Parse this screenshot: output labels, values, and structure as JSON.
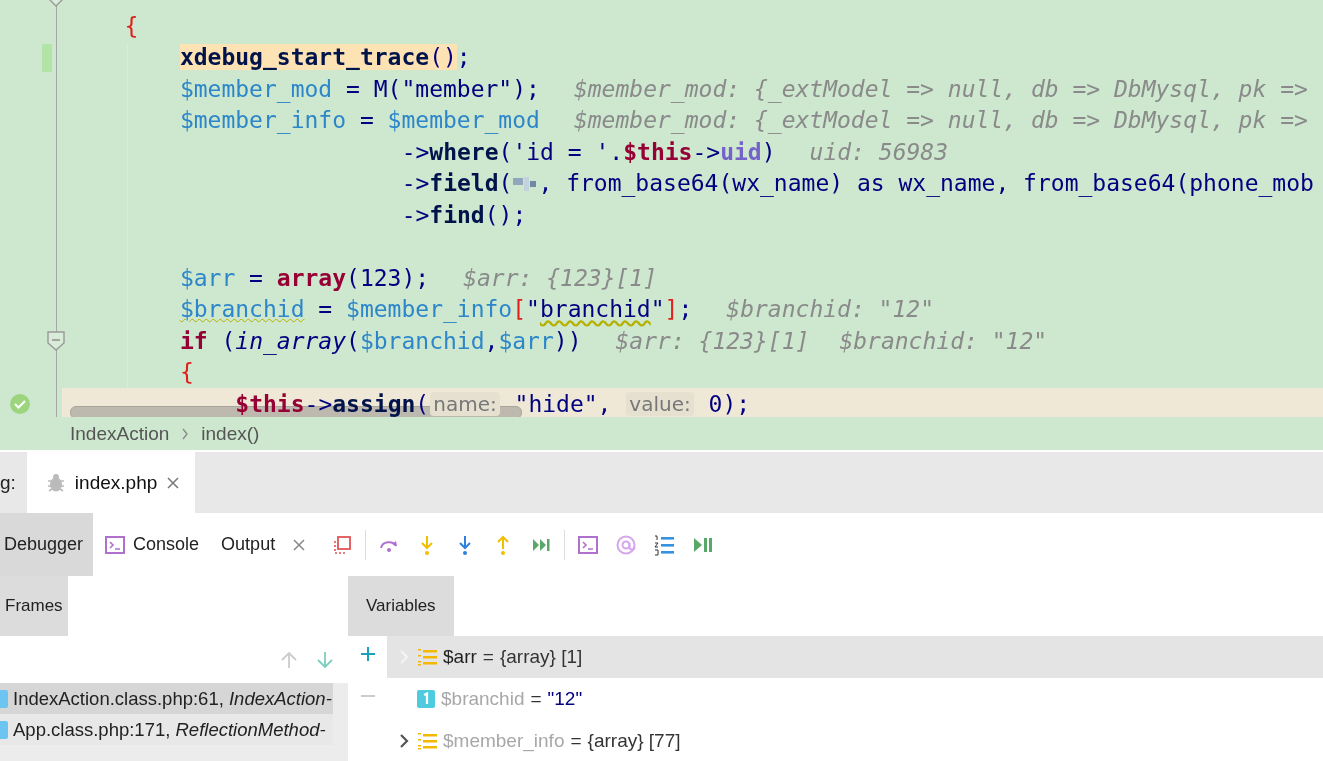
{
  "editor": {
    "lines": [
      {
        "kind": "block",
        "tokens": [
          {
            "t": "{",
            "kind": "brace"
          }
        ]
      },
      {
        "kind": "stmt",
        "tokens": [
          {
            "t": "xdebug_start_trace",
            "kind": "callmark"
          },
          {
            "t": "()",
            "kind": "textmark"
          },
          {
            "t": ";",
            "kind": "text"
          }
        ],
        "changed": true
      },
      {
        "kind": "stmt",
        "tokens": [
          {
            "t": "$member_mod",
            "kind": "var"
          },
          {
            "t": " = M(\"member\");",
            "kind": "text"
          }
        ],
        "hints": [
          "$member_mod: {_extModel => null, db => DbMysql, pk =>"
        ]
      },
      {
        "kind": "stmt",
        "tokens": [
          {
            "t": "$member_info",
            "kind": "var"
          },
          {
            "t": " = ",
            "kind": "text"
          },
          {
            "t": "$member_mod",
            "kind": "var"
          }
        ],
        "hints": [
          "$member_mod: {_extModel => null, db => DbMysql, pk =>"
        ]
      },
      {
        "kind": "chain",
        "tokens": [
          {
            "t": "->",
            "kind": "text"
          },
          {
            "t": "where",
            "kind": "call"
          },
          {
            "t": "('id = '.",
            "kind": "text"
          },
          {
            "t": "$this",
            "kind": "kw"
          },
          {
            "t": "->",
            "kind": "text"
          },
          {
            "t": "uid",
            "kind": "prop"
          },
          {
            "t": ")",
            "kind": "text"
          }
        ],
        "hints": [
          "uid: 56983"
        ]
      },
      {
        "kind": "chain",
        "tokens": [
          {
            "t": "->",
            "kind": "text"
          },
          {
            "t": "field",
            "kind": "call"
          },
          {
            "t": "(",
            "kind": "text"
          },
          {
            "kind": "redacted"
          },
          {
            "t": ", from_base64(wx_name) as wx_name, from_base64(phone_mob",
            "kind": "text"
          }
        ]
      },
      {
        "kind": "chain",
        "tokens": [
          {
            "t": "->",
            "kind": "text"
          },
          {
            "t": "find",
            "kind": "call"
          },
          {
            "t": "();",
            "kind": "text"
          }
        ]
      },
      {
        "kind": "blank"
      },
      {
        "kind": "stmt",
        "tokens": [
          {
            "t": "$arr",
            "kind": "var"
          },
          {
            "t": " = ",
            "kind": "text"
          },
          {
            "t": "array",
            "kind": "kw"
          },
          {
            "t": "(123);",
            "kind": "text"
          }
        ],
        "hints": [
          "$arr: {123}[1]"
        ]
      },
      {
        "kind": "stmt",
        "tokens": [
          {
            "t": "$branchid",
            "kind": "varwarn"
          },
          {
            "t": " = ",
            "kind": "text"
          },
          {
            "t": "$member_info",
            "kind": "var"
          },
          {
            "t": "[",
            "kind": "brace"
          },
          {
            "t": "\"",
            "kind": "text"
          },
          {
            "t": "branchid",
            "kind": "textwarn"
          },
          {
            "t": "\"",
            "kind": "text"
          },
          {
            "t": "]",
            "kind": "brace"
          },
          {
            "t": ";",
            "kind": "text"
          }
        ],
        "hints": [
          "$branchid: \"12\""
        ]
      },
      {
        "kind": "stmt",
        "tokens": [
          {
            "t": "if",
            "kind": "kw"
          },
          {
            "t": " (",
            "kind": "text"
          },
          {
            "t": "in_array",
            "kind": "italic"
          },
          {
            "t": "(",
            "kind": "text"
          },
          {
            "t": "$branchid",
            "kind": "var"
          },
          {
            "t": ",",
            "kind": "text"
          },
          {
            "t": "$arr",
            "kind": "var"
          },
          {
            "t": "))",
            "kind": "text"
          }
        ],
        "hints": [
          "$arr: {123}[1]",
          "$branchid: \"12\""
        ],
        "fold": true
      },
      {
        "kind": "stmt",
        "tokens": [
          {
            "t": "{",
            "kind": "brace"
          }
        ]
      },
      {
        "kind": "nested",
        "tokens": [
          {
            "t": "$this",
            "kind": "kw"
          },
          {
            "t": "->",
            "kind": "text"
          },
          {
            "t": "assign",
            "kind": "call"
          },
          {
            "t": "(",
            "kind": "text"
          },
          {
            "t": "name:",
            "kind": "param"
          },
          {
            "t": " \"hide\", ",
            "kind": "text"
          },
          {
            "t": "value:",
            "kind": "param"
          },
          {
            "t": " 0);",
            "kind": "text"
          }
        ],
        "current": true
      }
    ]
  },
  "breadcrumbs": [
    "IndexAction",
    "index()"
  ],
  "debug_bar": {
    "label": "g:",
    "tabs": [
      {
        "label": "index.php",
        "selected": true
      }
    ]
  },
  "tool_tabs": [
    {
      "label": "Debugger",
      "kind": "plain",
      "selected": true
    },
    {
      "label": "Console",
      "kind": "console",
      "selected": false
    },
    {
      "label": "Output",
      "kind": "closable",
      "selected": false
    }
  ],
  "frames": {
    "title": "Frames",
    "rows": [
      {
        "text": "IndexAction.class.php:61, *IndexAction-*",
        "selected": true
      },
      {
        "text": "App.class.php:171, *ReflectionMethod-*",
        "selected": false
      }
    ]
  },
  "variables": {
    "title": "Variables",
    "rows": [
      {
        "name": "$arr",
        "sep": "=",
        "value": "{array} [1]",
        "kind": "array",
        "selected": true,
        "dimmed": false
      },
      {
        "name": "$branchid",
        "sep": "=",
        "value": "\"12\"",
        "kind": "string",
        "selected": false,
        "dimmed": true
      },
      {
        "name": "$member_info",
        "sep": "=",
        "value": "{array} [77]",
        "kind": "array",
        "selected": false,
        "dimmed": true
      }
    ]
  }
}
